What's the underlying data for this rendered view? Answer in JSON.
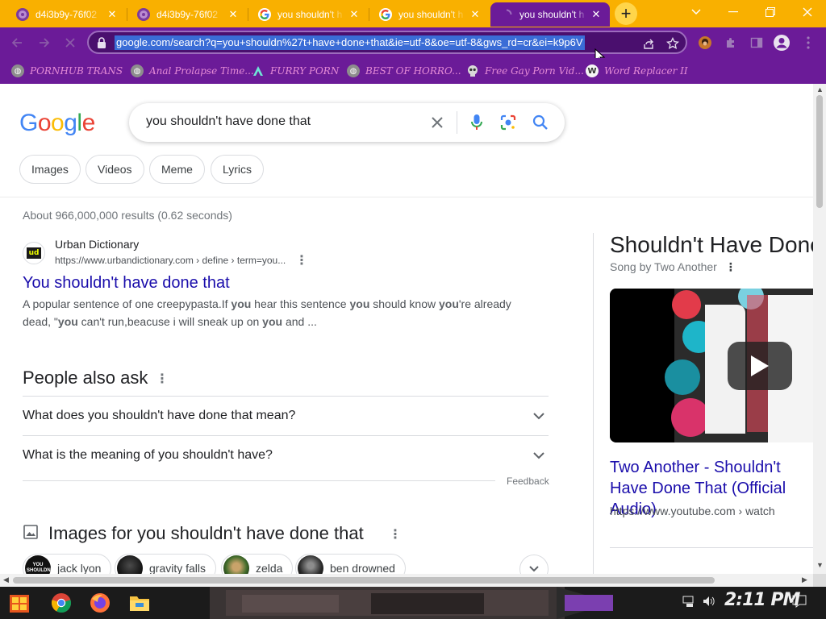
{
  "browser": {
    "tabs": [
      {
        "title": "d4i3b9y-76f02",
        "favicon": "purple-circle-icon"
      },
      {
        "title": "d4i3b9y-76f02",
        "favicon": "purple-circle-icon"
      },
      {
        "title": "you shouldn't h",
        "favicon": "google-g-icon"
      },
      {
        "title": "you shouldn't h",
        "favicon": "google-g-icon"
      },
      {
        "title": "you shouldn't h",
        "favicon": "spinner-icon"
      }
    ],
    "active_tab_index": 4,
    "new_tab_symbol": "+",
    "address_url": "google.com/search?q=you+shouldn%27t+have+done+that&ie=utf-8&oe=utf-8&gws_rd=cr&ei=k9p6V",
    "bookmarks": [
      {
        "label": "PORNHUB TRANS",
        "icon": "gray-globe-icon"
      },
      {
        "label": "Anal Prolapse Time...",
        "icon": "gray-globe-icon"
      },
      {
        "label": "FURRY PORN",
        "icon": "teal-arrow-icon"
      },
      {
        "label": "BEST OF HORRO...",
        "icon": "gray-globe-icon"
      },
      {
        "label": "Free Gay Porn Vid...",
        "icon": "skull-icon"
      },
      {
        "label": "Word Replacer II",
        "icon": "w-icon"
      }
    ],
    "colors": {
      "tabstrip": "#f9b000",
      "frame": "#6b1b98",
      "bookmark_text": "#e58bd6"
    }
  },
  "google": {
    "logo_letters": [
      {
        "ch": "G",
        "color": "#4285f4"
      },
      {
        "ch": "o",
        "color": "#ea4335"
      },
      {
        "ch": "o",
        "color": "#fbbc05"
      },
      {
        "ch": "g",
        "color": "#4285f4"
      },
      {
        "ch": "l",
        "color": "#34a853"
      },
      {
        "ch": "e",
        "color": "#ea4335"
      }
    ],
    "query": "you shouldn't have done that",
    "chips": [
      "Images",
      "Videos",
      "Meme",
      "Lyrics"
    ],
    "stats": "About 966,000,000 results (0.62 seconds)",
    "result": {
      "site_name": "Urban Dictionary",
      "favicon_text": "ud",
      "cite": "https://www.urbandictionary.com › define › term=you...",
      "title": "You shouldn't have done that",
      "snippet_parts": [
        {
          "t": "A popular sentence of one creepypasta.If ",
          "b": false
        },
        {
          "t": "you",
          "b": true
        },
        {
          "t": " hear this sentence ",
          "b": false
        },
        {
          "t": "you",
          "b": true
        },
        {
          "t": " should know ",
          "b": false
        },
        {
          "t": "you",
          "b": true
        },
        {
          "t": "'re already dead, \"",
          "b": false
        },
        {
          "t": "you",
          "b": true
        },
        {
          "t": " can't run,beacuse i will sneak up on ",
          "b": false
        },
        {
          "t": "you",
          "b": true
        },
        {
          "t": " and ...",
          "b": false
        }
      ]
    },
    "people_also_ask": {
      "title": "People also ask",
      "questions": [
        "What does you shouldn't have done that mean?",
        "What is the meaning of you shouldn't have?"
      ],
      "feedback": "Feedback"
    },
    "images_section": {
      "title": "Images for you shouldn't have done that",
      "pills": [
        {
          "label": "jack lyon",
          "thumb_text": "YOU SHOULDN'T"
        },
        {
          "label": "gravity falls"
        },
        {
          "label": "zelda"
        },
        {
          "label": "ben drowned"
        }
      ]
    },
    "knowledge_panel": {
      "title": "Shouldn't Have Done",
      "subtitle": "Song by Two Another",
      "video_link": "Two Another - Shouldn't Have Done That (Official Audio)",
      "video_cite": "https://www.youtube.com › watch"
    }
  },
  "taskbar": {
    "clock": "2:11 PM",
    "apps": [
      "start-icon",
      "chrome-icon",
      "firefox-icon",
      "file-explorer-icon"
    ]
  }
}
